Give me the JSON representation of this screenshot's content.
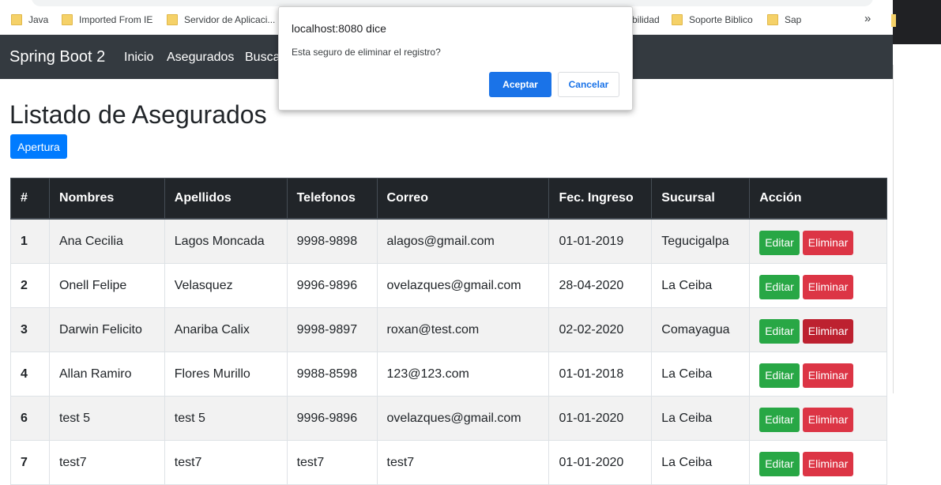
{
  "bookmarks": [
    {
      "label": "Java"
    },
    {
      "label": "Imported From IE"
    },
    {
      "label": "Servidor de Aplicaci..."
    },
    {
      "label": "bilidad"
    },
    {
      "label": "Soporte Biblico"
    },
    {
      "label": "Sap"
    }
  ],
  "more_bookmarks": "»",
  "navbar": {
    "brand": "Spring Boot 2",
    "links": [
      "Inicio",
      "Asegurados",
      "Busca"
    ]
  },
  "page_title": "Listado de Asegurados",
  "apertura_button": "Apertura",
  "table": {
    "headers": [
      "#",
      "Nombres",
      "Apellidos",
      "Telefonos",
      "Correo",
      "Fec. Ingreso",
      "Sucursal",
      "Acción"
    ],
    "rows": [
      {
        "id": "1",
        "nombres": "Ana Cecilia",
        "apellidos": "Lagos Moncada",
        "telefonos": "9998-9898",
        "correo": "alagos@gmail.com",
        "fecha": "01-01-2019",
        "sucursal": "Tegucigalpa"
      },
      {
        "id": "2",
        "nombres": "Onell Felipe",
        "apellidos": "Velasquez",
        "telefonos": "9996-9896",
        "correo": "ovelazques@gmail.com",
        "fecha": "28-04-2020",
        "sucursal": "La Ceiba"
      },
      {
        "id": "3",
        "nombres": "Darwin Felicito",
        "apellidos": "Anariba Calix",
        "telefonos": "9998-9897",
        "correo": "roxan@test.com",
        "fecha": "02-02-2020",
        "sucursal": "Comayagua"
      },
      {
        "id": "4",
        "nombres": "Allan Ramiro",
        "apellidos": "Flores Murillo",
        "telefonos": "9988-8598",
        "correo": "123@123.com",
        "fecha": "01-01-2018",
        "sucursal": "La Ceiba"
      },
      {
        "id": "6",
        "nombres": "test 5",
        "apellidos": "test 5",
        "telefonos": "9996-9896",
        "correo": "ovelazques@gmail.com",
        "fecha": "01-01-2020",
        "sucursal": "La Ceiba"
      },
      {
        "id": "7",
        "nombres": "test7",
        "apellidos": "test7",
        "telefonos": "test7",
        "correo": "test7",
        "fecha": "01-01-2020",
        "sucursal": "La Ceiba"
      }
    ],
    "edit_label": "Editar",
    "delete_label": "Eliminar"
  },
  "dialog": {
    "title": "localhost:8080 dice",
    "message": "Esta seguro de eliminar el registro?",
    "ok_label": "Aceptar",
    "cancel_label": "Cancelar"
  },
  "colors": {
    "navbar_bg": "#343a40",
    "primary": "#007bff",
    "edit": "#28a745",
    "delete": "#dc3545",
    "dialog_primary": "#1a73e8"
  },
  "icons": {
    "bookmark": "folder-icon",
    "more": "chevron-double-right-icon"
  }
}
